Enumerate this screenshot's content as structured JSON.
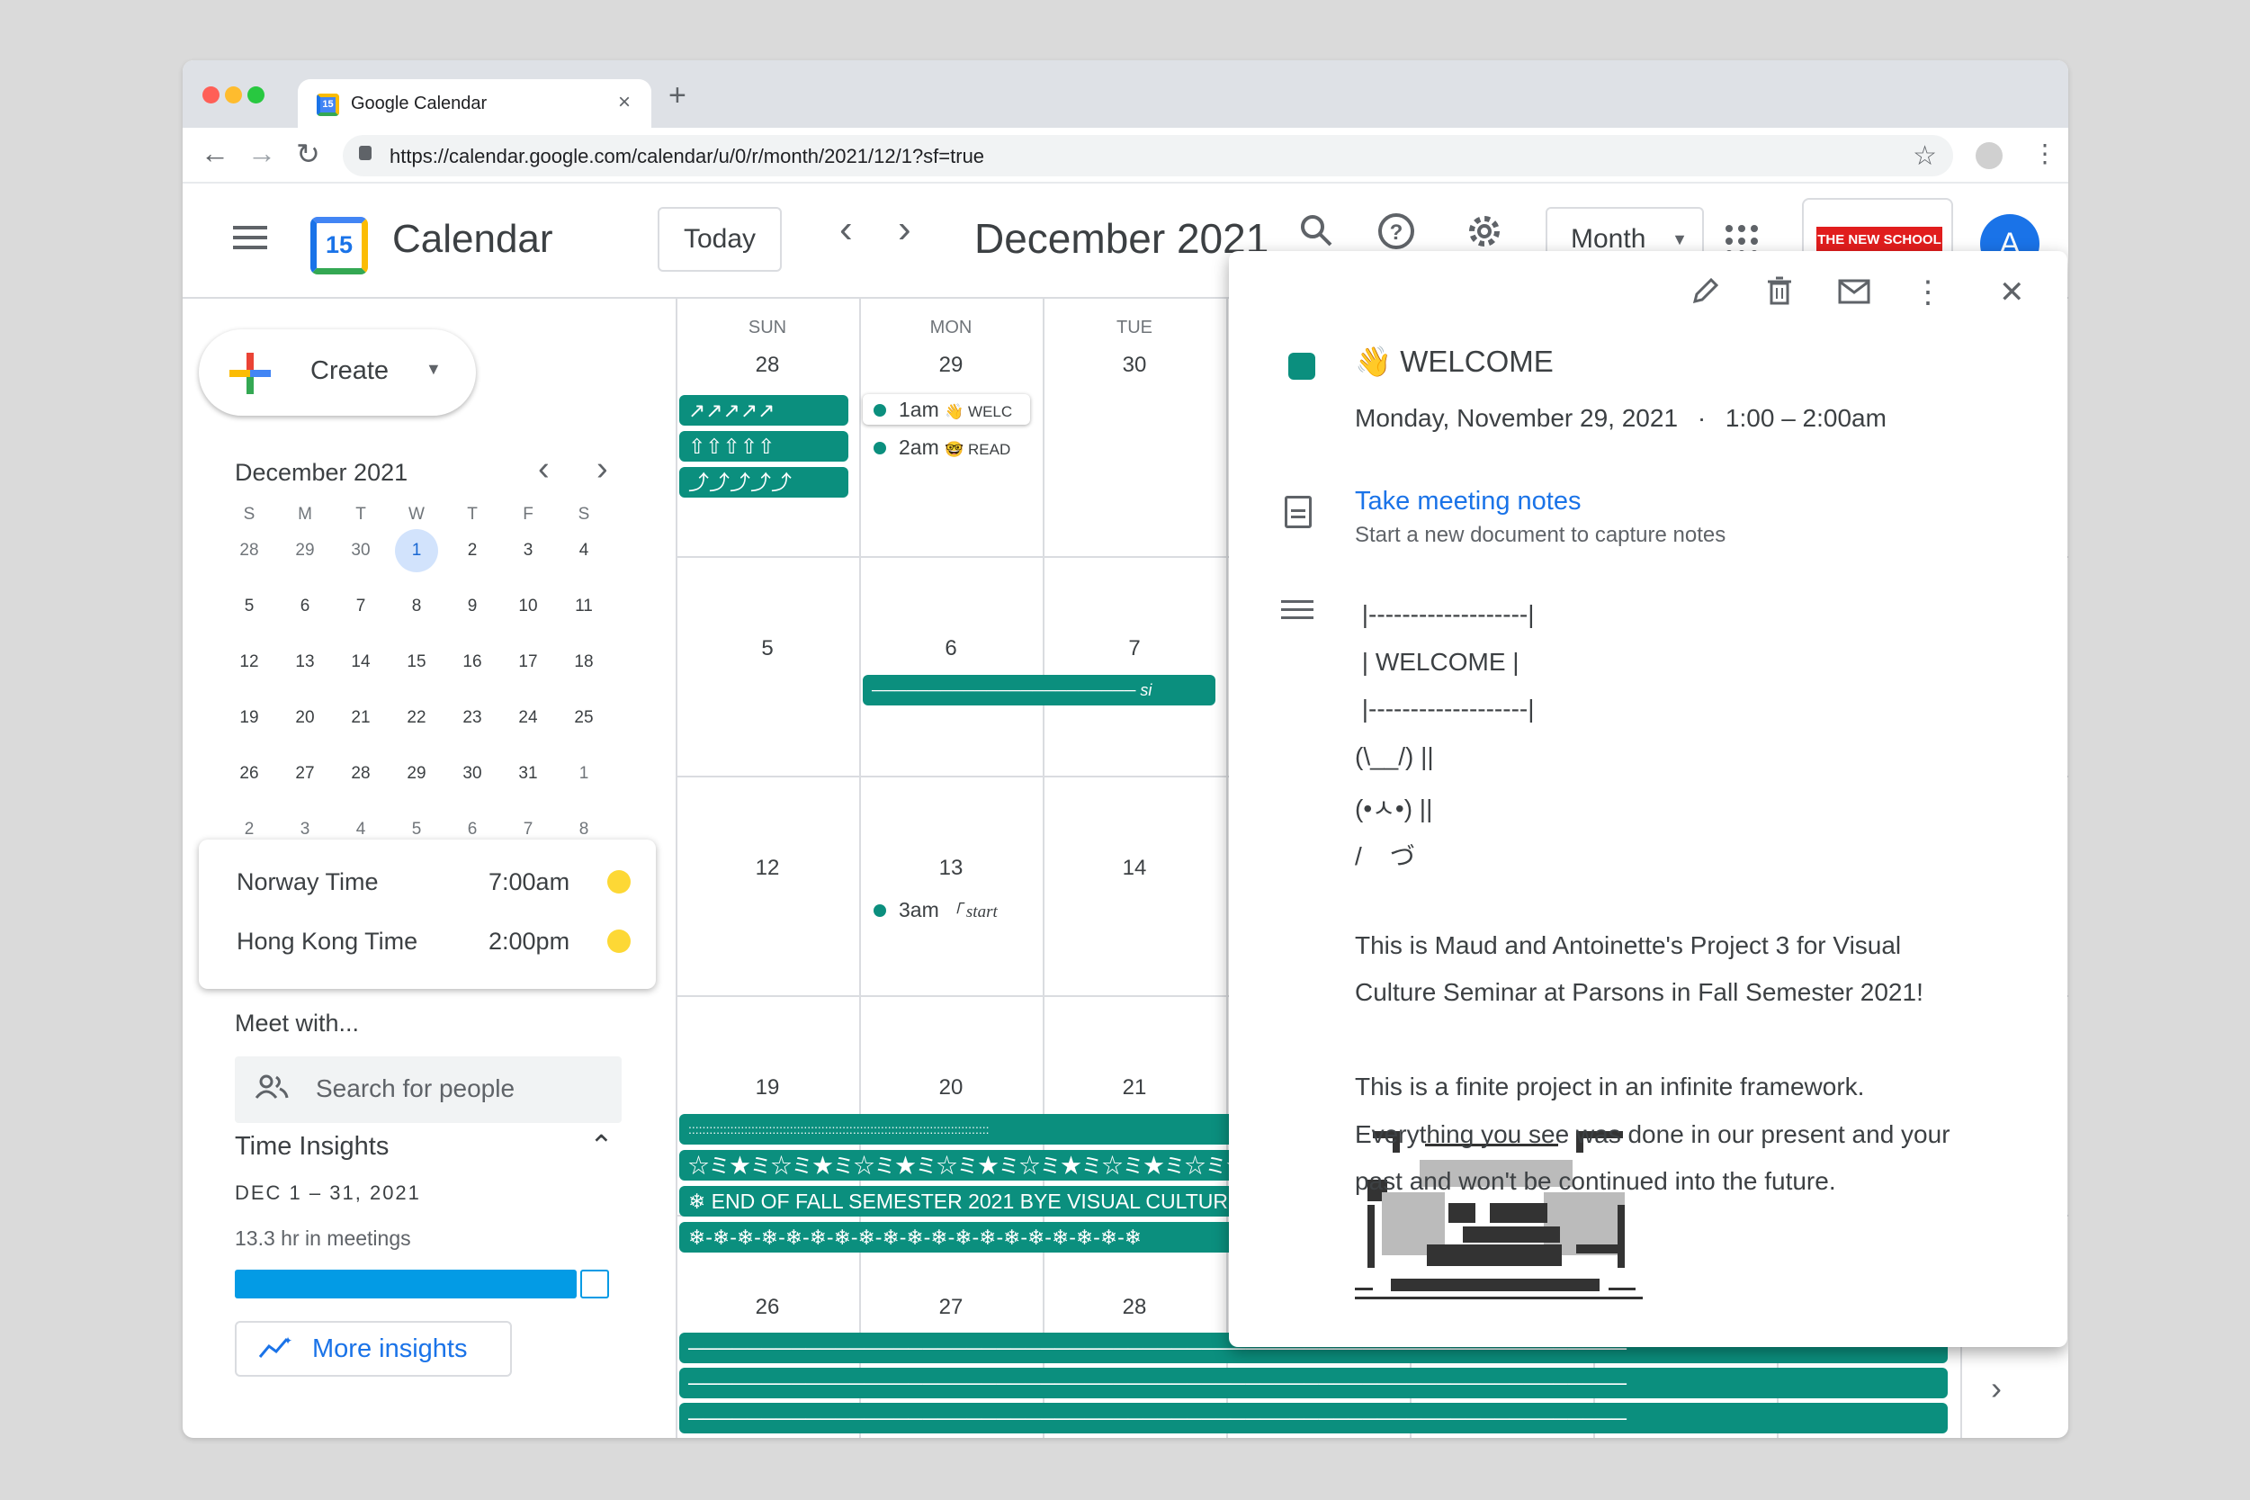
{
  "browser": {
    "tab_title": "Google Calendar",
    "tab_favicon_text": "15",
    "tab_close": "×",
    "new_tab": "+",
    "url": "https://calendar.google.com/calendar/u/0/r/month/2021/12/1?sf=true"
  },
  "header": {
    "logo_day": "15",
    "app_title": "Calendar",
    "today_label": "Today",
    "month_title": "December 2021",
    "view_label": "Month",
    "org_logo_text": "THE NEW SCHOOL",
    "avatar_letter": "A"
  },
  "sidebar": {
    "create_label": "Create",
    "mini_month": "December 2021",
    "mini_dow": [
      "S",
      "M",
      "T",
      "W",
      "T",
      "F",
      "S"
    ],
    "mini_weeks": [
      [
        "28",
        "29",
        "30",
        "1",
        "2",
        "3",
        "4"
      ],
      [
        "5",
        "6",
        "7",
        "8",
        "9",
        "10",
        "11"
      ],
      [
        "12",
        "13",
        "14",
        "15",
        "16",
        "17",
        "18"
      ],
      [
        "19",
        "20",
        "21",
        "22",
        "23",
        "24",
        "25"
      ],
      [
        "26",
        "27",
        "28",
        "29",
        "30",
        "31",
        "1"
      ],
      [
        "2",
        "3",
        "4",
        "5",
        "6",
        "7",
        "8"
      ]
    ],
    "world_clock": [
      {
        "zone": "Norway Time",
        "time": "7:00am"
      },
      {
        "zone": "Hong Kong Time",
        "time": "2:00pm"
      }
    ],
    "meet_with": "Meet with...",
    "search_placeholder": "Search for people",
    "insights_title": "Time Insights",
    "insights_range": "DEC 1 – 31, 2021",
    "insights_meetings": "13.3 hr in meetings",
    "more_insights": "More insights"
  },
  "grid": {
    "dow": [
      "SUN",
      "MON",
      "TUE"
    ],
    "week1_days": [
      "28",
      "29",
      "30"
    ],
    "week2_days": [
      "5",
      "6",
      "7"
    ],
    "week3_days": [
      "12",
      "13",
      "14"
    ],
    "week4_days": [
      "19",
      "20",
      "21"
    ],
    "week5_days": [
      "26",
      "27",
      "28"
    ],
    "week1_sun_bars": [
      "↗↗↗↗↗",
      "⇧⇧⇧⇧⇧",
      "⤴⤴⤴⤴⤴"
    ],
    "week1_mon_events": [
      {
        "time": "1am",
        "title": "👋 WELC"
      },
      {
        "time": "2am",
        "title": "🤓 READ"
      }
    ],
    "week2_bar": "─────────────────────── si",
    "week3_mon_event": {
      "time": "3am",
      "title": "「 start"
    },
    "week4_bars": [
      "::::::::::::::::::::::::::::::::::::::::::::::::::::::::::::::::::::::::::::::::::::::",
      "☆ミ★ミ☆ミ★ミ☆ミ★ミ☆ミ★ミ☆ミ★ミ☆ミ★ミ☆ミ★ミ☆ミ★",
      "❄ END OF FALL SEMESTER 2021 BYE VISUAL CULTURE",
      "❄-❄-❄-❄-❄-❄-❄-❄-❄-❄-❄-❄-❄-❄-❄-❄-❄-❄-❄"
    ],
    "week5_bars": [
      "────────────────────────────────────────────────────────────────",
      "────────────────────────────────────────────────────────────────",
      "────────────────────────────────────────────────────────────────",
      "────────────────────────────────────────────────────────────────"
    ]
  },
  "popup": {
    "title": "👋 WELCOME",
    "date": "Monday, November 29, 2021",
    "date_sep": "·",
    "time": "1:00 – 2:00am",
    "notes_link": "Take meeting notes",
    "notes_sub": "Start a new document to capture notes",
    "description": [
      " |-------------------|",
      " | WELCOME |",
      " |-------------------|",
      "(\\__/) ||",
      "(•ㅅ•) ||",
      "/    づ",
      "",
      "This is Maud and Antoinette's Project 3 for Visual",
      "Culture Seminar at Parsons in Fall Semester 2021!",
      "",
      "This is a finite project in an infinite framework.",
      "Everything you see was done in our present and your",
      "past and won't be continued into the future."
    ]
  },
  "colors": {
    "event_teal": "#0b8f7e",
    "primary_blue": "#1a73e8",
    "insight_bar": "#039be5",
    "selected_day_bg": "#d2e3fc"
  },
  "icons": [
    "back-arrow-icon",
    "forward-arrow-icon",
    "reload-icon",
    "lock-icon",
    "bookmark-star-icon",
    "menu-icon",
    "search-icon",
    "help-icon",
    "settings-icon",
    "apps-icon",
    "edit-icon",
    "delete-icon",
    "email-icon",
    "more-icon",
    "close-icon",
    "document-icon",
    "description-icon",
    "people-icon",
    "insights-icon"
  ]
}
